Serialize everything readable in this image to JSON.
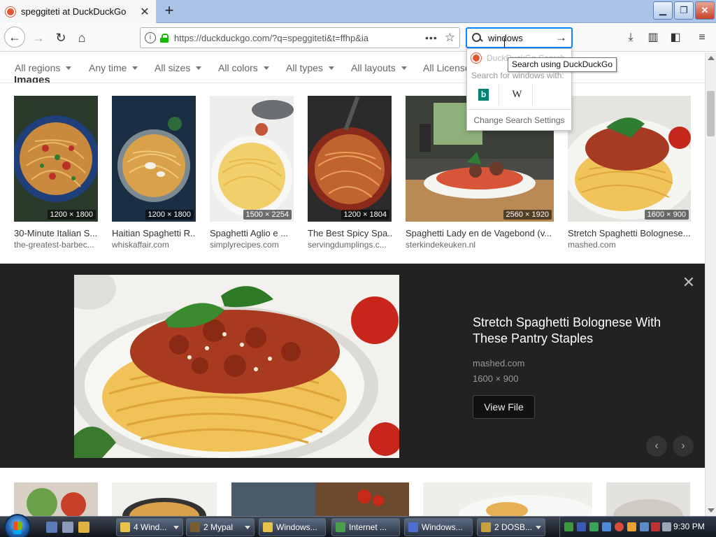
{
  "browser": {
    "tab_title": "speggiteti at DuckDuckGo",
    "new_tab_label": "+",
    "url": "https://duckduckgo.com/?q=speggiteti&t=ffhp&ia",
    "search_value": "windows"
  },
  "search_popup": {
    "engine_label": "DuckDuckGo Search",
    "search_with_label": "Search for windows with:",
    "tooltip": "Search using DuckDuckGo",
    "settings_label": "Change Search Settings",
    "engines": [
      "bing",
      "wikipedia"
    ]
  },
  "filters": [
    {
      "label": "All regions"
    },
    {
      "label": "Any time"
    },
    {
      "label": "All sizes"
    },
    {
      "label": "All colors"
    },
    {
      "label": "All types"
    },
    {
      "label": "All layouts"
    },
    {
      "label": "All License"
    }
  ],
  "section_label": "Images",
  "results": [
    {
      "dims": "1200 × 1800",
      "title": "30-Minute Italian S...",
      "source": "the-greatest-barbec..."
    },
    {
      "dims": "1200 × 1800",
      "title": "Haitian Spaghetti R...",
      "source": "whiskaffair.com"
    },
    {
      "dims": "1500 × 2254",
      "title": "Spaghetti Aglio e ...",
      "source": "simplyrecipes.com"
    },
    {
      "dims": "1200 × 1804",
      "title": "The Best Spicy Spa...",
      "source": "servingdumplings.c..."
    },
    {
      "dims": "2560 × 1920",
      "title": "Spaghetti Lady en de Vagebond (v...",
      "source": "sterkindekeuken.nl"
    },
    {
      "dims": "1600 × 900",
      "title": "Stretch Spaghetti Bolognese...",
      "source": "mashed.com"
    }
  ],
  "detail": {
    "title": "Stretch Spaghetti Bolognese With These Pantry Staples",
    "source": "mashed.com",
    "dims": "1600 × 900",
    "view_file_label": "View File"
  },
  "taskbar": {
    "tasks": [
      {
        "label": "4 Wind...",
        "icon_color": "#e8c34a"
      },
      {
        "label": "2 Mypal",
        "icon_color": "#7a5c2e"
      },
      {
        "label": "Windows...",
        "icon_color": "#e8c34a"
      },
      {
        "label": "Internet ...",
        "icon_color": "#4aa04a"
      },
      {
        "label": "Windows...",
        "icon_color": "#4c6fd1"
      },
      {
        "label": "2 DOSB...",
        "icon_color": "#c8a040"
      }
    ],
    "clock": "9:30 PM"
  },
  "colors": {
    "tab_bar": "#aac4e8",
    "search_focus": "#0a84ff",
    "ddg_orange": "#de5833",
    "detail_bg": "#222222"
  }
}
